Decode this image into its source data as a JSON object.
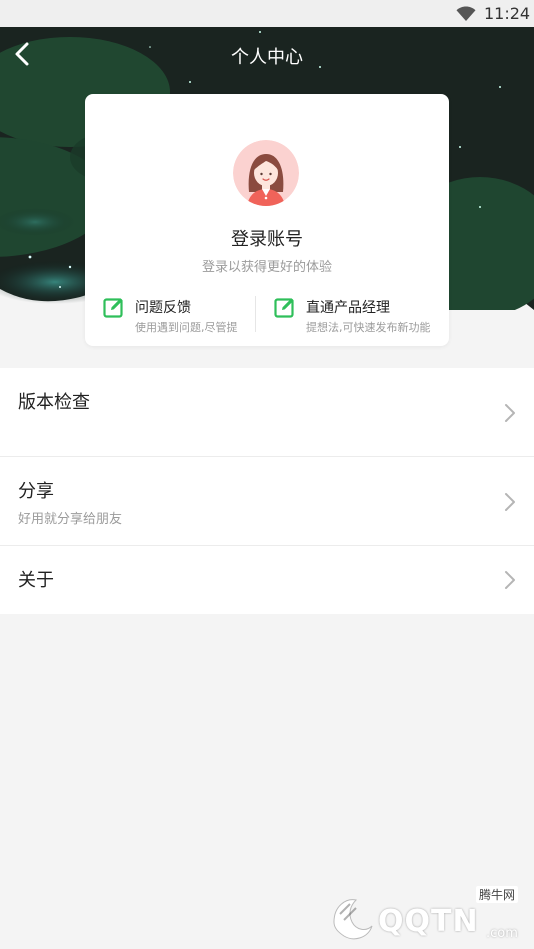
{
  "status_bar": {
    "time": "11:24",
    "wifi_icon": "wifi-icon"
  },
  "header": {
    "title": "个人中心",
    "back_icon": "chevron-left-icon"
  },
  "profile_card": {
    "avatar_icon": "avatar-girl-icon",
    "login_title": "登录账号",
    "login_subtitle": "登录以获得更好的体验",
    "actions": [
      {
        "icon": "edit-icon",
        "title": "问题反馈",
        "subtitle": "使用遇到问题,尽管提"
      },
      {
        "icon": "edit-icon",
        "title": "直通产品经理",
        "subtitle": "提想法,可快速发布新功能"
      }
    ]
  },
  "menu": [
    {
      "title": "版本检查",
      "subtitle": ""
    },
    {
      "title": "分享",
      "subtitle": "好用就分享给朋友"
    },
    {
      "title": "关于",
      "subtitle": ""
    }
  ],
  "watermark": {
    "brand": "QQTN",
    "cn": "腾牛网",
    "domain": ".com"
  },
  "colors": {
    "accent_green": "#2fbf5a",
    "header_dark": "#1f2a26",
    "leaf_green": "#1e4a2f",
    "text_primary": "#222222",
    "text_secondary": "#9b9b9b",
    "avatar_bg": "#fbd2d0"
  }
}
